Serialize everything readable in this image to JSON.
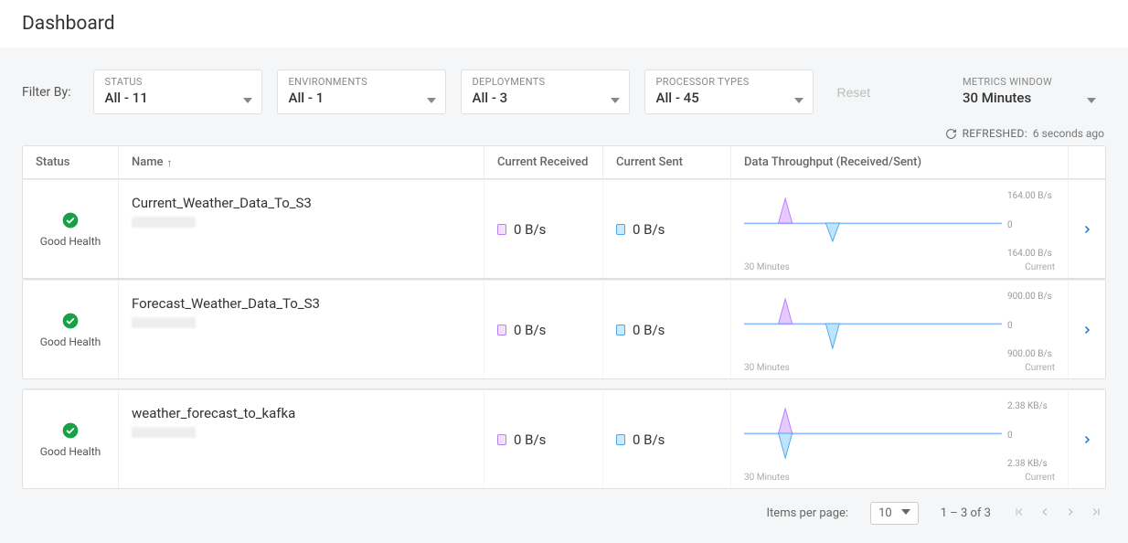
{
  "header": {
    "title": "Dashboard"
  },
  "filters": {
    "label": "Filter By:",
    "status": {
      "label": "STATUS",
      "value": "All - 11"
    },
    "environments": {
      "label": "ENVIRONMENTS",
      "value": "All - 1"
    },
    "deployments": {
      "label": "DEPLOYMENTS",
      "value": "All - 3"
    },
    "processor_types": {
      "label": "PROCESSOR TYPES",
      "value": "All - 45"
    },
    "reset_label": "Reset",
    "metrics_window": {
      "label": "METRICS WINDOW",
      "value": "30 Minutes"
    }
  },
  "refresh": {
    "label": "REFRESHED:",
    "value": "6 seconds ago"
  },
  "table": {
    "columns": {
      "status": "Status",
      "name": "Name",
      "received": "Current Received",
      "sent": "Current Sent",
      "throughput": "Data Throughput (Received/Sent)"
    },
    "sort": {
      "column": "name",
      "direction": "asc"
    },
    "rows": [
      {
        "status": "Good Health",
        "name": "Current_Weather_Data_To_S3",
        "received": "0 B/s",
        "sent": "0 B/s",
        "chart": {
          "x_left": "30 Minutes",
          "x_right": "Current",
          "y_top": "164.00 B/s",
          "y_mid": "0",
          "y_bot": "164.00 B/s"
        }
      },
      {
        "status": "Good Health",
        "name": "Forecast_Weather_Data_To_S3",
        "received": "0 B/s",
        "sent": "0 B/s",
        "chart": {
          "x_left": "30 Minutes",
          "x_right": "Current",
          "y_top": "900.00 B/s",
          "y_mid": "0",
          "y_bot": "900.00 B/s"
        }
      },
      {
        "status": "Good Health",
        "name": "weather_forecast_to_kafka",
        "received": "0 B/s",
        "sent": "0 B/s",
        "chart": {
          "x_left": "30 Minutes",
          "x_right": "Current",
          "y_top": "2.38 KB/s",
          "y_mid": "0",
          "y_bot": "2.38 KB/s"
        }
      }
    ]
  },
  "pager": {
    "items_label": "Items per page:",
    "items_value": "10",
    "range": "1 – 3 of 3"
  }
}
